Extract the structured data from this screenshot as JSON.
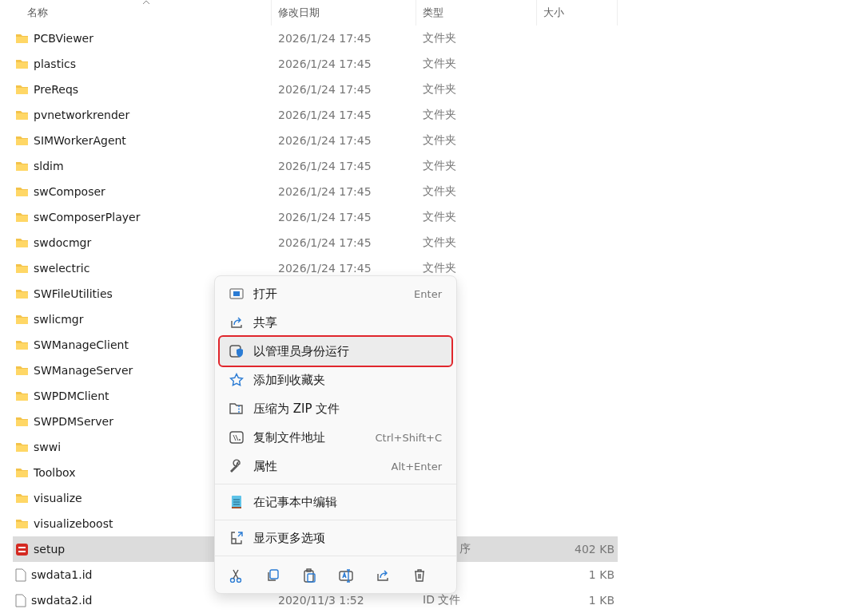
{
  "columns": [
    {
      "label": "名称",
      "sorted": true
    },
    {
      "label": "修改日期",
      "sorted": false
    },
    {
      "label": "类型",
      "sorted": false
    },
    {
      "label": "大小",
      "sorted": false
    }
  ],
  "rows": [
    {
      "kind": "folder",
      "name": "PCBViewer",
      "date": "2026/1/24 17:45",
      "type": "文件夹",
      "selected": false
    },
    {
      "kind": "folder",
      "name": "plastics",
      "date": "2026/1/24 17:45",
      "type": "文件夹",
      "selected": false
    },
    {
      "kind": "folder",
      "name": "PreReqs",
      "date": "2026/1/24 17:45",
      "type": "文件夹",
      "selected": false
    },
    {
      "kind": "folder",
      "name": "pvnetworkrender",
      "date": "2026/1/24 17:45",
      "type": "文件夹",
      "selected": false
    },
    {
      "kind": "folder",
      "name": "SIMWorkerAgent",
      "date": "2026/1/24 17:45",
      "type": "文件夹",
      "selected": false
    },
    {
      "kind": "folder",
      "name": "sldim",
      "date": "2026/1/24 17:45",
      "type": "文件夹",
      "selected": false
    },
    {
      "kind": "folder",
      "name": "swComposer",
      "date": "2026/1/24 17:45",
      "type": "文件夹",
      "selected": false
    },
    {
      "kind": "folder",
      "name": "swComposerPlayer",
      "date": "2026/1/24 17:45",
      "type": "文件夹",
      "selected": false
    },
    {
      "kind": "folder",
      "name": "swdocmgr",
      "date": "2026/1/24 17:45",
      "type": "文件夹",
      "selected": false
    },
    {
      "kind": "folder",
      "name": "swelectric",
      "date": "2026/1/24 17:45",
      "type": "文件夹",
      "selected": false
    },
    {
      "kind": "folder",
      "name": "SWFileUtilities",
      "selected": false
    },
    {
      "kind": "folder",
      "name": "swlicmgr",
      "selected": false
    },
    {
      "kind": "folder",
      "name": "SWManageClient",
      "selected": false
    },
    {
      "kind": "folder",
      "name": "SWManageServer",
      "selected": false
    },
    {
      "kind": "folder",
      "name": "SWPDMClient",
      "selected": false
    },
    {
      "kind": "folder",
      "name": "SWPDMServer",
      "selected": false
    },
    {
      "kind": "folder",
      "name": "swwi",
      "selected": false
    },
    {
      "kind": "folder",
      "name": "Toolbox",
      "selected": false
    },
    {
      "kind": "folder",
      "name": "visualize",
      "selected": false
    },
    {
      "kind": "folder",
      "name": "visualizeboost",
      "selected": false
    },
    {
      "kind": "app",
      "name": "setup",
      "type": "序",
      "type_clipped": true,
      "size": "402 KB",
      "selected": true
    },
    {
      "kind": "file",
      "name": "swdata1.id",
      "size": "1 KB",
      "selected": false
    },
    {
      "kind": "file",
      "name": "swdata2.id",
      "date": "2020/11/3 1:52",
      "type": "ID 文件",
      "size": "1 KB",
      "selected": false
    }
  ],
  "context_menu": {
    "items": [
      {
        "kind": "item",
        "label": "打开",
        "shortcut": "Enter",
        "highlighted": false
      },
      {
        "kind": "item",
        "label": "共享",
        "highlighted": false
      },
      {
        "kind": "item",
        "label": "以管理员身份运行",
        "highlighted": true
      },
      {
        "kind": "item",
        "label": "添加到收藏夹",
        "highlighted": false
      },
      {
        "kind": "item",
        "label": "压缩为 ZIP 文件",
        "highlighted": false
      },
      {
        "kind": "item",
        "label": "复制文件地址",
        "shortcut": "Ctrl+Shift+C",
        "highlighted": false
      },
      {
        "kind": "item",
        "label": "属性",
        "shortcut": "Alt+Enter",
        "highlighted": false
      },
      {
        "kind": "separator"
      },
      {
        "kind": "item",
        "label": "在记事本中编辑",
        "highlighted": false
      },
      {
        "kind": "separator"
      },
      {
        "kind": "item",
        "label": "显示更多选项",
        "highlighted": false
      },
      {
        "kind": "separator"
      }
    ]
  }
}
